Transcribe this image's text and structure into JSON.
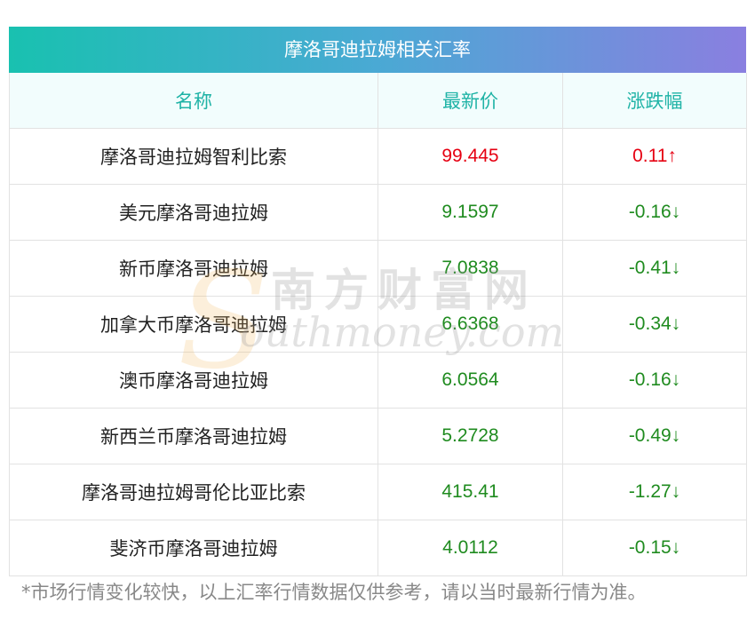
{
  "title": "摩洛哥迪拉姆相关汇率",
  "columns": [
    "名称",
    "最新价",
    "涨跌幅"
  ],
  "rows": [
    {
      "name": "摩洛哥迪拉姆智利比索",
      "price": "99.445",
      "change": "0.11↑",
      "direction": "up"
    },
    {
      "name": "美元摩洛哥迪拉姆",
      "price": "9.1597",
      "change": "-0.16↓",
      "direction": "down"
    },
    {
      "name": "新币摩洛哥迪拉姆",
      "price": "7.0838",
      "change": "-0.41↓",
      "direction": "down"
    },
    {
      "name": "加拿大币摩洛哥迪拉姆",
      "price": "6.6368",
      "change": "-0.34↓",
      "direction": "down"
    },
    {
      "name": "澳币摩洛哥迪拉姆",
      "price": "6.0564",
      "change": "-0.16↓",
      "direction": "down"
    },
    {
      "name": "新西兰币摩洛哥迪拉姆",
      "price": "5.2728",
      "change": "-0.49↓",
      "direction": "down"
    },
    {
      "name": "摩洛哥迪拉姆哥伦比亚比索",
      "price": "415.41",
      "change": "-1.27↓",
      "direction": "down"
    },
    {
      "name": "斐济币摩洛哥迪拉姆",
      "price": "4.0112",
      "change": "-0.15↓",
      "direction": "down"
    }
  ],
  "footnote": "*市场行情变化较快，以上汇率行情数据仅供参考，请以当时最新行情为准。",
  "watermark": {
    "s": "S",
    "cn": "南方财富网",
    "en": "outhmoney.com"
  },
  "colors": {
    "up": "#e60012",
    "down": "#1f8b1f",
    "header_text": "#1fb3a6",
    "title_gradient_start": "#19c1b0",
    "title_gradient_end": "#8a7fe0"
  }
}
